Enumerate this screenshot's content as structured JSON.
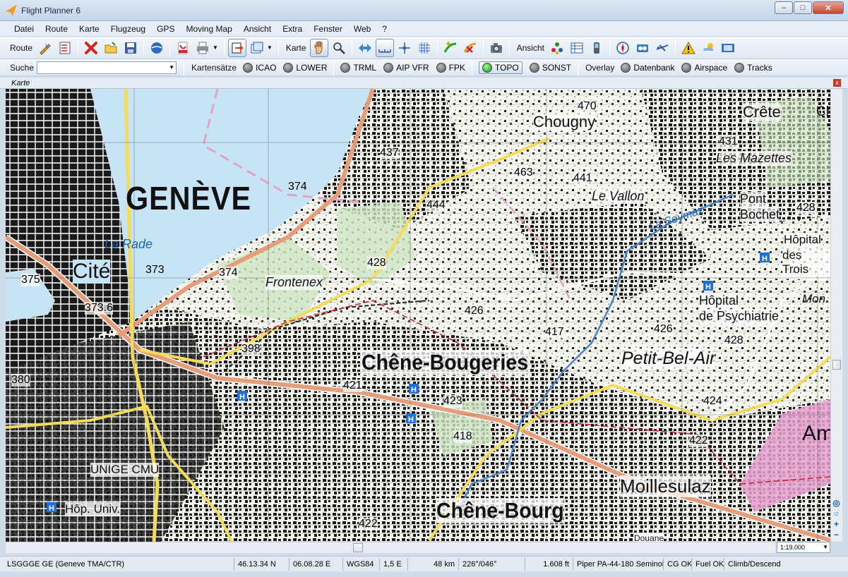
{
  "window": {
    "title": "Flight Planner 6",
    "controls": {
      "minimize": "–",
      "maximize": "□",
      "close": "✕"
    }
  },
  "menu": [
    "Datei",
    "Route",
    "Karte",
    "Flugzeug",
    "GPS",
    "Moving Map",
    "Ansicht",
    "Extra",
    "Fenster",
    "Web",
    "?"
  ],
  "toolbar": {
    "route_label": "Route",
    "karte_label": "Karte",
    "ansicht_label": "Ansicht"
  },
  "toolbar2": {
    "search_label": "Suche",
    "search_value": "",
    "kartensaetze_label": "Kartensätze",
    "kartensaetze": [
      {
        "label": "ICAO",
        "active": false
      },
      {
        "label": "LOWER",
        "active": false
      },
      {
        "label": "TRML",
        "active": false
      },
      {
        "label": "AIP VFR",
        "active": false
      },
      {
        "label": "FPK",
        "active": false
      },
      {
        "label": "TOPO",
        "active": true
      },
      {
        "label": "SONST",
        "active": false
      }
    ],
    "overlay_label": "Overlay",
    "overlays": [
      {
        "label": "Datenbank"
      },
      {
        "label": "Airspace"
      },
      {
        "label": "Tracks"
      }
    ]
  },
  "panel": {
    "title": "Karte",
    "close": "x"
  },
  "map": {
    "labels": {
      "geneve": "GENÈVE",
      "cite": "Cité",
      "la_rade": "La Rade",
      "frontenex": "Frontenex",
      "chene_bougeries": "Chêne-Bougeries",
      "chene_bourg": "Chêne-Bourg",
      "petit_bel_air": "Petit-Bel-Air",
      "moillesulaz": "Moillesulaz",
      "chougny": "Chougny",
      "le_vallon": "Le Vallon",
      "les_mazettes": "Les Mazettes",
      "crete": "Crête",
      "pont_bochet_1": "Pont",
      "pont_bochet_2": "Bochet",
      "la_seymaz": "La Seymaz",
      "hopital_trois_1": "Hôpital",
      "hopital_trois_2": "des Trois",
      "hopital_psy_1": "Hôpital",
      "hopital_psy_2": "de Psychiatrie",
      "unige": "UNIGE CMU",
      "hop_univ": "Hôp. Univ.",
      "mon": "Mon",
      "am": "Am",
      "douane": "Douane",
      "ch": "Ch"
    },
    "elevations": [
      "470",
      "437",
      "463",
      "441",
      "431",
      "374",
      "444",
      "428",
      "375",
      "373",
      "373.6",
      "374",
      "428",
      "426",
      "417",
      "426",
      "428",
      "398",
      "380",
      "421",
      "423",
      "418",
      "424",
      "422",
      "422"
    ]
  },
  "scale": {
    "value": "1:19.000"
  },
  "statusbar": {
    "airspace": "LSGGGE GE (Geneve TMA/CTR)",
    "lat": "46.13.34 N",
    "lon": "06.08.28 E",
    "datum": "WGS84",
    "variation": "1,5 E",
    "distance": "48 km",
    "bearing": "226°/046°",
    "altitude": "1.608 ft",
    "aircraft": "Piper PA-44-180 Seminole",
    "cg": "CG OK",
    "fuel": "Fuel OK",
    "phase": "Climb/Descend"
  }
}
